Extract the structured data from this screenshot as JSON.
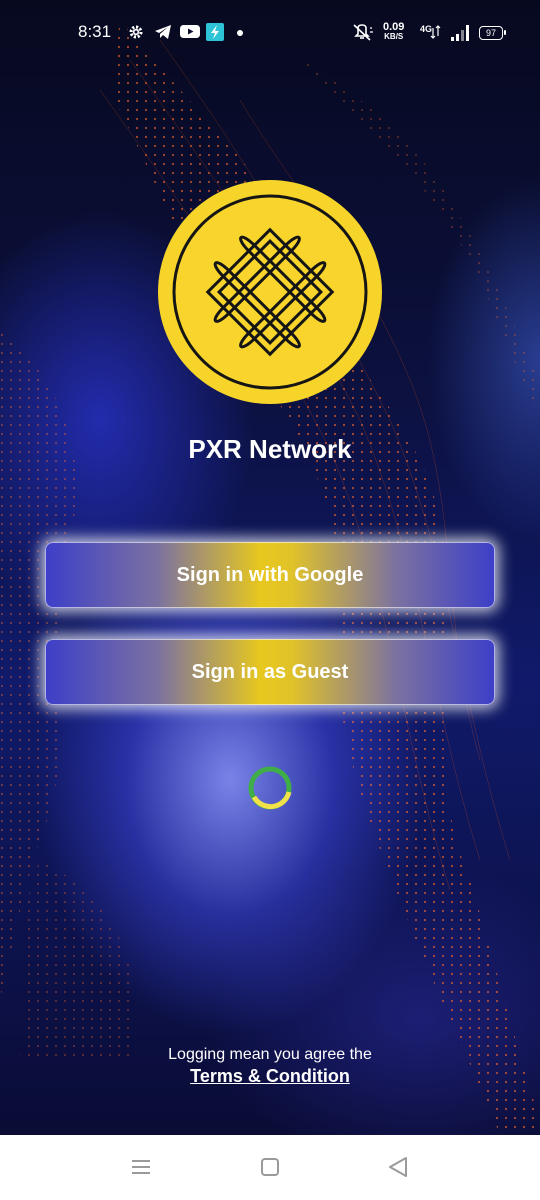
{
  "status_bar": {
    "time": "8:31",
    "net_speed_value": "0.09",
    "net_speed_unit": "KB/S",
    "network_type": "4G",
    "battery": "97",
    "left_icons": [
      "settings-icon",
      "telegram-icon",
      "youtube-icon",
      "app-icon",
      "dot-icon"
    ],
    "right_icons": [
      "mute-icon",
      "signal-icon",
      "battery-icon"
    ]
  },
  "app": {
    "name": "PXR Network",
    "logo_icon": "endless-knot-icon",
    "accent_color": "#f5d21e",
    "primary_color": "#3d3fc8"
  },
  "buttons": {
    "google_label": "Sign in with Google",
    "guest_label": "Sign in as Guest"
  },
  "loading": {
    "icon": "loading-spinner-icon"
  },
  "legal": {
    "notice": "Logging mean you agree the",
    "terms_link": "Terms & Condition"
  },
  "nav_bar": {
    "icons": [
      "menu-icon",
      "home-icon",
      "back-icon"
    ]
  }
}
